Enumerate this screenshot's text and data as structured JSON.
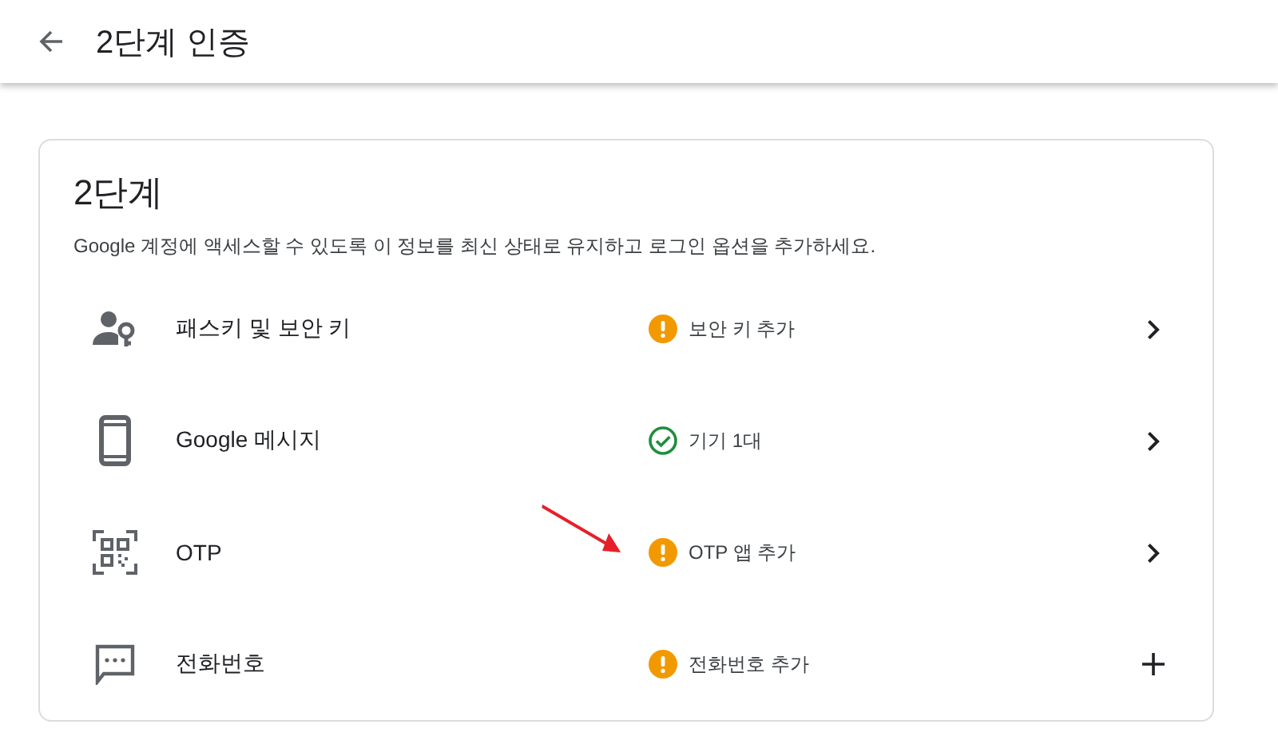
{
  "header": {
    "title": "2단계 인증"
  },
  "card": {
    "title": "2단계",
    "description": "Google 계정에 액세스할 수 있도록 이 정보를 최신 상태로 유지하고 로그인 옵션을 추가하세요.",
    "rows": [
      {
        "kind": "passkey",
        "label": "패스키 및 보안 키",
        "status": {
          "kind": "warning",
          "text": "보안 키 추가"
        }
      },
      {
        "kind": "phone",
        "label": "Google 메시지",
        "status": {
          "kind": "ok",
          "text": "기기 1대"
        }
      },
      {
        "kind": "qr",
        "label": "OTP",
        "status": {
          "kind": "warning",
          "text": "OTP 앱 추가"
        },
        "annotated": true
      },
      {
        "kind": "message",
        "label": "전화번호",
        "status": {
          "kind": "warning",
          "text": "전화번호 추가"
        }
      }
    ]
  }
}
